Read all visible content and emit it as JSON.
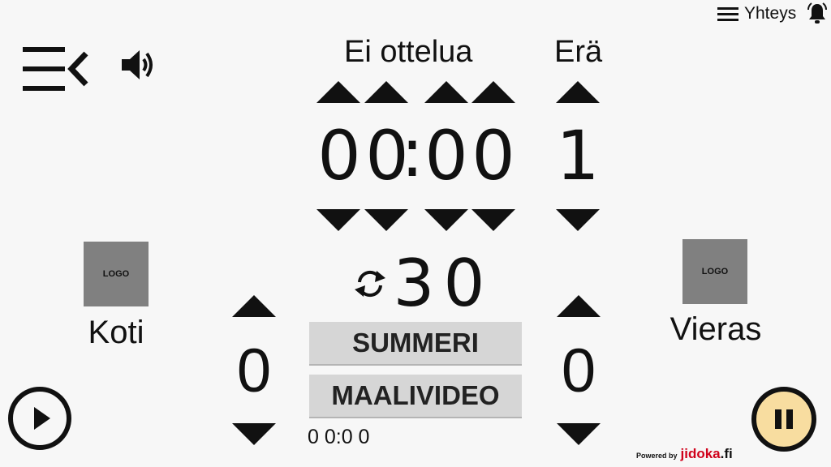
{
  "topbar": {
    "connection_label": "Yhteys",
    "menu_icon": "hamburger-icon",
    "alarm_icon": "bell-icon"
  },
  "match": {
    "title": "Ei ottelua",
    "period_label": "Erä",
    "period_value": "1"
  },
  "clock": {
    "d1": "0",
    "d2": "0",
    "sep": ":",
    "d3": "0",
    "d4": "0"
  },
  "shot_clock": {
    "d1": "3",
    "d2": "0",
    "icon": "refresh-icon"
  },
  "home": {
    "logo_text": "LOGO",
    "name": "Koti",
    "score": "0"
  },
  "away": {
    "logo_text": "LOGO",
    "name": "Vieras",
    "score": "0"
  },
  "buttons": {
    "buzzer": "SUMMERI",
    "goal_video": "MAALIVIDEO"
  },
  "secondary_time": "0 0:0 0",
  "footer": {
    "powered_by": "Powered by",
    "brand": "jidoka",
    "brand_suffix": ".fi"
  },
  "colors": {
    "background": "#f7f7f7",
    "pause_fill": "#f8dda0",
    "button_grey": "#d6d6d6",
    "logo_grey": "#808080",
    "brand_red": "#d0021b"
  }
}
